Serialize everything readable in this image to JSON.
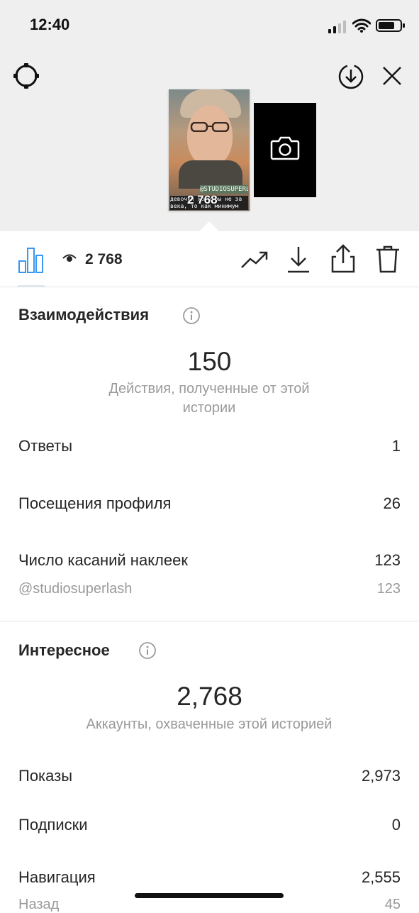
{
  "status_bar": {
    "time": "12:40"
  },
  "story": {
    "overlay_views": "2 768",
    "sticker_tag": "@STUDIOSUPERLASH",
    "caption": "девочки хотя бы не за века, то как минимум"
  },
  "toolbar": {
    "views": "2 768"
  },
  "interactions": {
    "title": "Взаимодействия",
    "total": "150",
    "total_desc": "Действия, полученные от этой истории",
    "rows": [
      {
        "label": "Ответы",
        "value": "1"
      },
      {
        "label": "Посещения профиля",
        "value": "26"
      },
      {
        "label": "Число касаний наклеек",
        "value": "123"
      }
    ],
    "sub_row": {
      "label": "@studiosuperlash",
      "value": "123"
    }
  },
  "discovery": {
    "title": "Интересное",
    "total": "2,768",
    "total_desc": "Аккаунты, охваченные этой историей",
    "rows": [
      {
        "label": "Показы",
        "value": "2,973"
      },
      {
        "label": "Подписки",
        "value": "0"
      },
      {
        "label": "Навигация",
        "value": "2,555"
      }
    ],
    "sub_row": {
      "label": "Назад",
      "value": "45"
    }
  },
  "colors": {
    "accent": "#3897f0",
    "text": "#262626",
    "muted": "#9a9a9a",
    "top_bg": "#efefef"
  }
}
